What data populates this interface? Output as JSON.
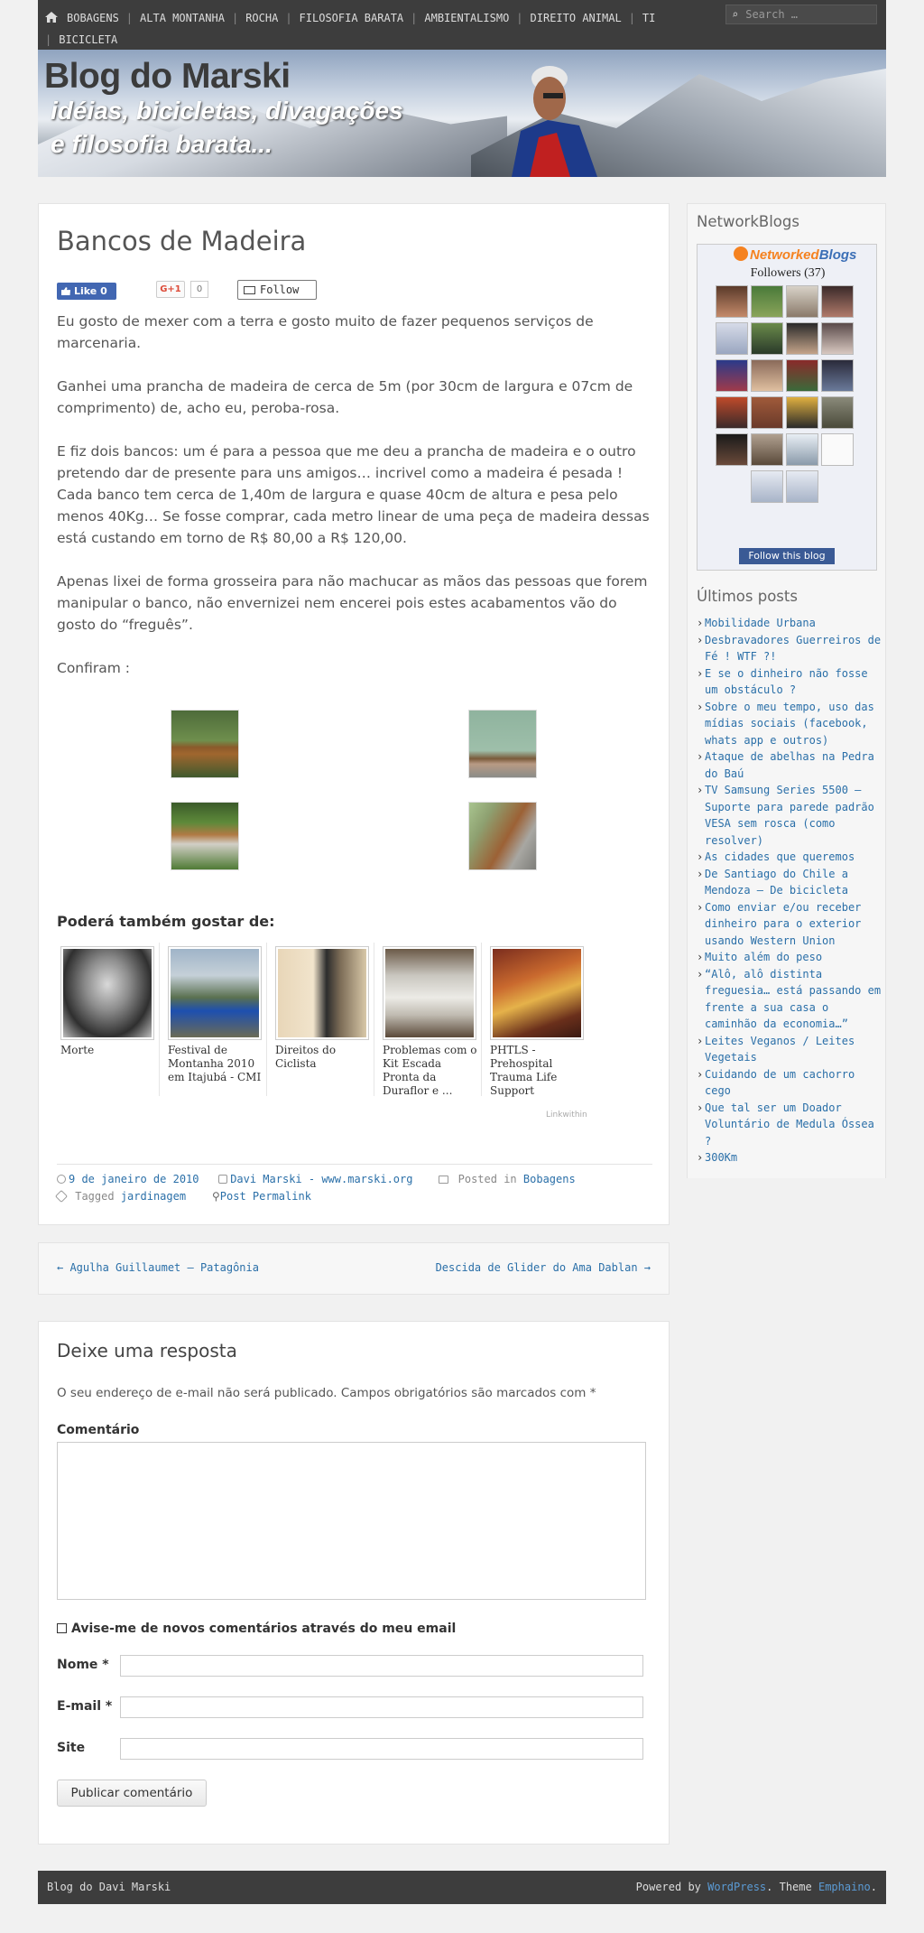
{
  "nav": {
    "items": [
      "BOBAGENS",
      "ALTA MONTANHA",
      "ROCHA",
      "FILOSOFIA BARATA",
      "AMBIENTALISMO",
      "DIREITO ANIMAL",
      "TI",
      "BICICLETA"
    ],
    "search_placeholder": "Search …"
  },
  "banner": {
    "title": "Blog do Marski",
    "tagline1": "idéias, bicicletas, divagações",
    "tagline2": "e filosofia barata..."
  },
  "post": {
    "title": "Bancos de Madeira",
    "like_label": "Like",
    "like_count": "0",
    "gplus_label": "G+1",
    "gplus_count": "0",
    "follow_label": "Follow",
    "paragraphs": [
      "Eu gosto de mexer com a terra e gosto muito de fazer pequenos serviços de marcenaria.",
      "Ganhei uma prancha de madeira de cerca de 5m (por 30cm de largura e 07cm de comprimento) de, acho eu, peroba-rosa.",
      "E fiz dois bancos:  um é para a pessoa que me deu a prancha de madeira e o outro pretendo dar de presente para uns amigos… incrivel como a madeira é pesada ! Cada banco tem cerca de 1,40m de largura e quase 40cm de altura e pesa pelo menos 40Kg…  Se fosse comprar, cada metro linear de uma peça de madeira dessas está custando em torno de R$ 80,00 a R$ 120,00.",
      "Apenas lixei de forma grosseira para não machucar as mãos das pessoas que forem manipular o banco, não envernizei nem encerei pois estes acabamentos vão do gosto do “freguês”.",
      "Confiram :"
    ],
    "related_heading": "Poderá também gostar de:",
    "related": [
      {
        "caption": "Morte"
      },
      {
        "caption": "Festival de Montanha 2010 em Itajubá - CMI"
      },
      {
        "caption": "Direitos do Ciclista"
      },
      {
        "caption": "Problemas com o Kit Escada Pronta da Duraflor e ..."
      },
      {
        "caption": "PHTLS - Prehospital Trauma Life Support"
      }
    ],
    "linkwithin": "Linkwithin",
    "date": "9 de janeiro de 2010",
    "author": "Davi Marski - www.marski.org",
    "posted_in_label": "Posted in",
    "category": "Bobagens",
    "tagged_label": "Tagged",
    "tag": "jardinagem",
    "permalink": "Post Permalink"
  },
  "post_nav": {
    "prev": "← Agulha Guillaumet – Patagônia",
    "next": "Descida de Glider do Ama Dablan →"
  },
  "comments": {
    "heading": "Deixe uma resposta",
    "note": "O seu endereço de e-mail não será publicado. Campos obrigatórios são marcados com *",
    "comment_label": "Comentário",
    "notify_label": "Avise-me de novos comentários através do meu email",
    "name_label": "Nome *",
    "email_label": "E-mail *",
    "site_label": "Site",
    "submit_label": "Publicar comentário"
  },
  "sidebar": {
    "networkblogs_title": "NetworkBlogs",
    "nb_logo_1": "Networked",
    "nb_logo_2": "Blogs",
    "followers": "Followers (37)",
    "follow_blog": "Follow this blog",
    "recent_title": "Últimos posts",
    "recent_posts": [
      "Mobilidade Urbana",
      "Desbravadores Guerreiros de Fé ! WTF ?!",
      "E se o dinheiro não fosse um obstáculo ?",
      "Sobre o meu tempo, uso das mídias sociais (facebook, whats app e outros)",
      "Ataque de abelhas na Pedra do Baú",
      "TV Samsung Series 5500 – Suporte para parede padrão VESA sem rosca (como resolver)",
      "As cidades que queremos",
      "De Santiago do Chile a Mendoza – De bicicleta",
      "Como enviar e/ou receber dinheiro para o exterior usando Western Union",
      "Muito além do peso",
      "“Alô, alô distinta freguesia… está passando em frente a sua casa o caminhão da economia…”",
      "Leites Veganos / Leites Vegetais",
      "Cuidando de um cachorro cego",
      "Que tal ser um Doador Voluntário de Medula Óssea ?",
      "300Km"
    ]
  },
  "footer": {
    "left": "Blog do Davi Marski",
    "powered_by": "Powered by",
    "wordpress": "WordPress",
    "theme_label": ". Theme",
    "theme": "Emphaino",
    "end": "."
  }
}
